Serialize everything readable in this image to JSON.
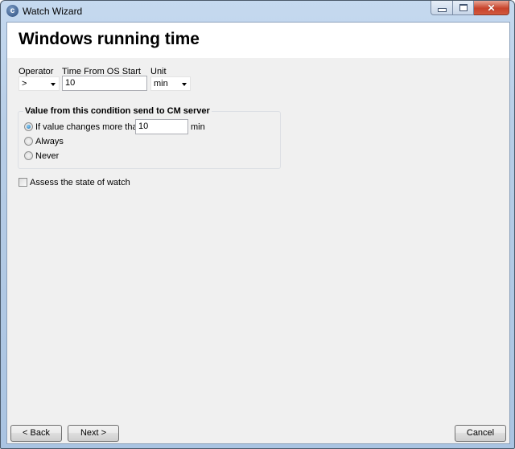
{
  "window": {
    "title": "Watch Wizard",
    "icon": "app-c-icon",
    "controls": [
      "minimize-icon",
      "maximize-icon",
      "close-icon"
    ]
  },
  "header": {
    "title": "Windows running time"
  },
  "condition": {
    "operator_label": "Operator",
    "operator_value": ">",
    "time_label": "Time From OS Start",
    "time_value": "10",
    "unit_label": "Unit",
    "unit_value": "min"
  },
  "send_group": {
    "title": "Value from this condition send to CM server",
    "options": [
      {
        "label": "If value changes more than",
        "selected": true
      },
      {
        "label": "Always",
        "selected": false
      },
      {
        "label": "Never",
        "selected": false
      }
    ],
    "threshold_value": "10",
    "threshold_unit": "min"
  },
  "assess": {
    "label": "Assess the state of watch",
    "checked": false
  },
  "footer": {
    "back": "< Back",
    "next": "Next >",
    "cancel": "Cancel"
  }
}
